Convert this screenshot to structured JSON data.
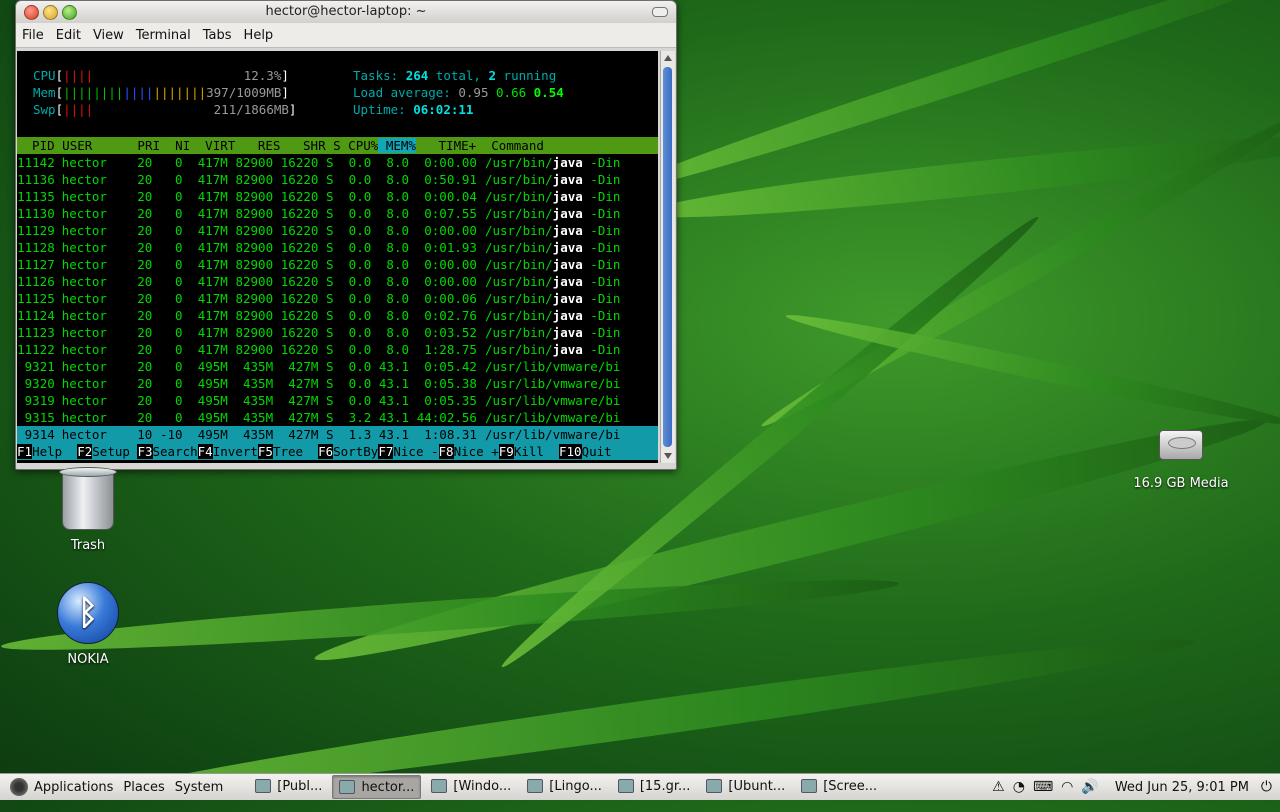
{
  "window": {
    "title": "hector@hector-laptop: ~",
    "menu": [
      "File",
      "Edit",
      "View",
      "Terminal",
      "Tabs",
      "Help"
    ]
  },
  "htop": {
    "cpu": {
      "label": "CPU",
      "bar": "||||",
      "value": "12.3%"
    },
    "mem": {
      "label": "Mem",
      "bar_green": "||||||||",
      "bar_blue": "||||",
      "bar_yellow": "|||||||",
      "value": "397/1009MB"
    },
    "swp": {
      "label": "Swp",
      "bar": "||||",
      "value": "211/1866MB"
    },
    "tasks": {
      "label": "Tasks:",
      "total": "264",
      "total_word": "total,",
      "running": "2",
      "running_word": "running"
    },
    "load": {
      "label": "Load average:",
      "v1": "0.95",
      "v5": "0.66",
      "v15": "0.54"
    },
    "uptime": {
      "label": "Uptime:",
      "value": "06:02:11"
    },
    "header": {
      "pid": "  PID",
      "user": " USER     ",
      "pri": " PRI",
      "ni": "  NI",
      "virt": "  VIRT",
      "res": "   RES",
      "shr": "   SHR",
      "s": " S",
      "cpu": " CPU%",
      "mem": " MEM%",
      "time": "   TIME+ ",
      "command": " Command"
    },
    "rows": [
      {
        "pid": "11142",
        "user": "hector",
        "pri": "20",
        "ni": "0",
        "virt": "417M",
        "res": "82900",
        "shr": "16220",
        "s": "S",
        "cpu": "0.0",
        "mem": "8.0",
        "time": "0:00.00",
        "cmd_pre": "/usr/bin/",
        "cmd_b": "java",
        "cmd_post": " -Din"
      },
      {
        "pid": "11136",
        "user": "hector",
        "pri": "20",
        "ni": "0",
        "virt": "417M",
        "res": "82900",
        "shr": "16220",
        "s": "S",
        "cpu": "0.0",
        "mem": "8.0",
        "time": "0:50.91",
        "cmd_pre": "/usr/bin/",
        "cmd_b": "java",
        "cmd_post": " -Din"
      },
      {
        "pid": "11135",
        "user": "hector",
        "pri": "20",
        "ni": "0",
        "virt": "417M",
        "res": "82900",
        "shr": "16220",
        "s": "S",
        "cpu": "0.0",
        "mem": "8.0",
        "time": "0:00.04",
        "cmd_pre": "/usr/bin/",
        "cmd_b": "java",
        "cmd_post": " -Din"
      },
      {
        "pid": "11130",
        "user": "hector",
        "pri": "20",
        "ni": "0",
        "virt": "417M",
        "res": "82900",
        "shr": "16220",
        "s": "S",
        "cpu": "0.0",
        "mem": "8.0",
        "time": "0:07.55",
        "cmd_pre": "/usr/bin/",
        "cmd_b": "java",
        "cmd_post": " -Din"
      },
      {
        "pid": "11129",
        "user": "hector",
        "pri": "20",
        "ni": "0",
        "virt": "417M",
        "res": "82900",
        "shr": "16220",
        "s": "S",
        "cpu": "0.0",
        "mem": "8.0",
        "time": "0:00.00",
        "cmd_pre": "/usr/bin/",
        "cmd_b": "java",
        "cmd_post": " -Din"
      },
      {
        "pid": "11128",
        "user": "hector",
        "pri": "20",
        "ni": "0",
        "virt": "417M",
        "res": "82900",
        "shr": "16220",
        "s": "S",
        "cpu": "0.0",
        "mem": "8.0",
        "time": "0:01.93",
        "cmd_pre": "/usr/bin/",
        "cmd_b": "java",
        "cmd_post": " -Din"
      },
      {
        "pid": "11127",
        "user": "hector",
        "pri": "20",
        "ni": "0",
        "virt": "417M",
        "res": "82900",
        "shr": "16220",
        "s": "S",
        "cpu": "0.0",
        "mem": "8.0",
        "time": "0:00.00",
        "cmd_pre": "/usr/bin/",
        "cmd_b": "java",
        "cmd_post": " -Din"
      },
      {
        "pid": "11126",
        "user": "hector",
        "pri": "20",
        "ni": "0",
        "virt": "417M",
        "res": "82900",
        "shr": "16220",
        "s": "S",
        "cpu": "0.0",
        "mem": "8.0",
        "time": "0:00.00",
        "cmd_pre": "/usr/bin/",
        "cmd_b": "java",
        "cmd_post": " -Din"
      },
      {
        "pid": "11125",
        "user": "hector",
        "pri": "20",
        "ni": "0",
        "virt": "417M",
        "res": "82900",
        "shr": "16220",
        "s": "S",
        "cpu": "0.0",
        "mem": "8.0",
        "time": "0:00.06",
        "cmd_pre": "/usr/bin/",
        "cmd_b": "java",
        "cmd_post": " -Din"
      },
      {
        "pid": "11124",
        "user": "hector",
        "pri": "20",
        "ni": "0",
        "virt": "417M",
        "res": "82900",
        "shr": "16220",
        "s": "S",
        "cpu": "0.0",
        "mem": "8.0",
        "time": "0:02.76",
        "cmd_pre": "/usr/bin/",
        "cmd_b": "java",
        "cmd_post": " -Din"
      },
      {
        "pid": "11123",
        "user": "hector",
        "pri": "20",
        "ni": "0",
        "virt": "417M",
        "res": "82900",
        "shr": "16220",
        "s": "S",
        "cpu": "0.0",
        "mem": "8.0",
        "time": "0:03.52",
        "cmd_pre": "/usr/bin/",
        "cmd_b": "java",
        "cmd_post": " -Din"
      },
      {
        "pid": "11122",
        "user": "hector",
        "pri": "20",
        "ni": "0",
        "virt": "417M",
        "res": "82900",
        "shr": "16220",
        "s": "S",
        "cpu": "0.0",
        "mem": "8.0",
        "time": "1:28.75",
        "cmd_pre": "/usr/bin/",
        "cmd_b": "java",
        "cmd_post": " -Din"
      },
      {
        "pid": "9321",
        "user": "hector",
        "pri": "20",
        "ni": "0",
        "virt": "495M",
        "res": "435M",
        "shr": "427M",
        "s": "S",
        "cpu": "0.0",
        "mem": "43.1",
        "time": "0:05.42",
        "cmd_pre": "/usr/lib/vmware/bi",
        "cmd_b": "",
        "cmd_post": ""
      },
      {
        "pid": "9320",
        "user": "hector",
        "pri": "20",
        "ni": "0",
        "virt": "495M",
        "res": "435M",
        "shr": "427M",
        "s": "S",
        "cpu": "0.0",
        "mem": "43.1",
        "time": "0:05.38",
        "cmd_pre": "/usr/lib/vmware/bi",
        "cmd_b": "",
        "cmd_post": ""
      },
      {
        "pid": "9319",
        "user": "hector",
        "pri": "20",
        "ni": "0",
        "virt": "495M",
        "res": "435M",
        "shr": "427M",
        "s": "S",
        "cpu": "0.0",
        "mem": "43.1",
        "time": "0:05.35",
        "cmd_pre": "/usr/lib/vmware/bi",
        "cmd_b": "",
        "cmd_post": ""
      },
      {
        "pid": "9315",
        "user": "hector",
        "pri": "20",
        "ni": "0",
        "virt": "495M",
        "res": "435M",
        "shr": "427M",
        "s": "S",
        "cpu": "3.2",
        "mem": "43.1",
        "time": "44:02.56",
        "cmd_pre": "/usr/lib/vmware/bi",
        "cmd_b": "",
        "cmd_post": ""
      },
      {
        "pid": "9314",
        "user": "hector",
        "pri": "10",
        "ni": "-10",
        "virt": "495M",
        "res": "435M",
        "shr": "427M",
        "s": "S",
        "cpu": "1.3",
        "mem": "43.1",
        "time": "1:08.31",
        "cmd_pre": "/usr/lib/vmware/bi",
        "cmd_b": "",
        "cmd_post": "",
        "selected": true
      }
    ],
    "fkeys": [
      {
        "key": "F1",
        "label": "Help  "
      },
      {
        "key": "F2",
        "label": "Setup "
      },
      {
        "key": "F3",
        "label": "Search"
      },
      {
        "key": "F4",
        "label": "Invert"
      },
      {
        "key": "F5",
        "label": "Tree  "
      },
      {
        "key": "F6",
        "label": "SortBy"
      },
      {
        "key": "F7",
        "label": "Nice -"
      },
      {
        "key": "F8",
        "label": "Nice +"
      },
      {
        "key": "F9",
        "label": "Kill  "
      },
      {
        "key": "F10",
        "label": "Quit"
      }
    ]
  },
  "desktop": {
    "trash": "Trash",
    "nokia": "NOKIA",
    "media": "16.9 GB Media"
  },
  "panel": {
    "menus": [
      "Applications",
      "Places",
      "System"
    ],
    "tasks": [
      {
        "label": "[Publ...",
        "active": false
      },
      {
        "label": "hector...",
        "active": true
      },
      {
        "label": "[Windo...",
        "active": false
      },
      {
        "label": "[Lingo...",
        "active": false
      },
      {
        "label": "[15.gr...",
        "active": false
      },
      {
        "label": "[Ubunt...",
        "active": false
      },
      {
        "label": "[Scree...",
        "active": false
      }
    ],
    "clock": "Wed Jun 25,  9:01 PM"
  }
}
